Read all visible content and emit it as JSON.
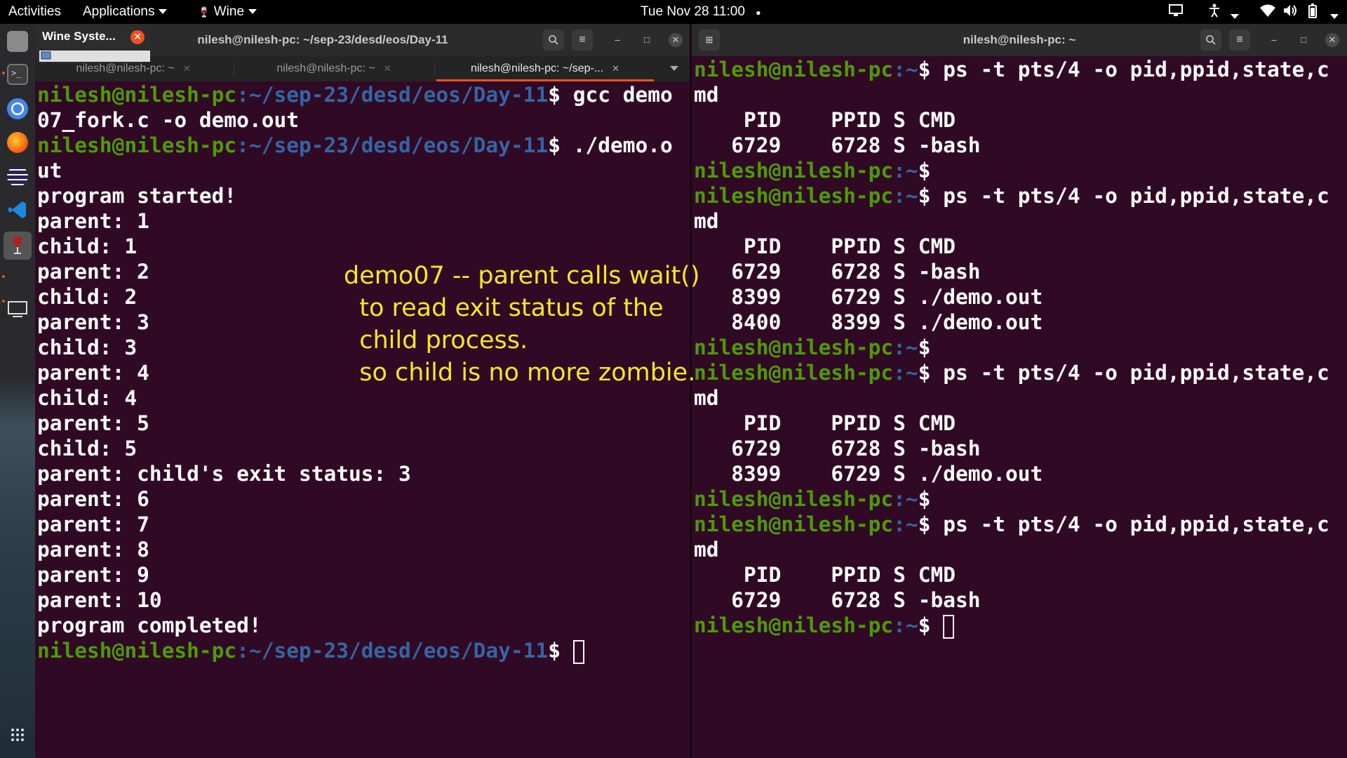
{
  "topbar": {
    "activities": "Activities",
    "applications": "Applications",
    "wine": "Wine",
    "clock": "Tue Nov 28  11:00"
  },
  "dock": {
    "items": [
      "files-icon",
      "terminal-icon",
      "chrome-icon",
      "firefox-icon",
      "eclipse-icon",
      "vscode-icon",
      "wine-icon",
      "screen-icon",
      "apps-grid-icon"
    ]
  },
  "wine_popup": {
    "title": "Wine Syste..."
  },
  "left_terminal": {
    "title": "nilesh@nilesh-pc: ~/sep-23/desd/eos/Day-11",
    "tabs": [
      {
        "label": "nilesh@nilesh-pc: ~"
      },
      {
        "label": "nilesh@nilesh-pc: ~"
      },
      {
        "label": "nilesh@nilesh-pc: ~/sep-..."
      }
    ],
    "prompt_user": "nilesh@nilesh-pc",
    "prompt_path": ":~/sep-23/desd/eos/Day-11",
    "lines": [
      {
        "type": "prompt",
        "cmd": "$ gcc demo"
      },
      {
        "type": "out",
        "text": "07_fork.c -o demo.out"
      },
      {
        "type": "prompt",
        "cmd": "$ ./demo.o"
      },
      {
        "type": "out",
        "text": "ut"
      },
      {
        "type": "out",
        "text": "program started!"
      },
      {
        "type": "out",
        "text": "parent: 1"
      },
      {
        "type": "out",
        "text": "child: 1"
      },
      {
        "type": "out",
        "text": "parent: 2"
      },
      {
        "type": "out",
        "text": "child: 2"
      },
      {
        "type": "out",
        "text": "parent: 3"
      },
      {
        "type": "out",
        "text": "child: 3"
      },
      {
        "type": "out",
        "text": "parent: 4"
      },
      {
        "type": "out",
        "text": "child: 4"
      },
      {
        "type": "out",
        "text": "parent: 5"
      },
      {
        "type": "out",
        "text": "child: 5"
      },
      {
        "type": "out",
        "text": "parent: child's exit status: 3"
      },
      {
        "type": "out",
        "text": "parent: 6"
      },
      {
        "type": "out",
        "text": "parent: 7"
      },
      {
        "type": "out",
        "text": "parent: 8"
      },
      {
        "type": "out",
        "text": "parent: 9"
      },
      {
        "type": "out",
        "text": "parent: 10"
      },
      {
        "type": "out",
        "text": "program completed!"
      },
      {
        "type": "prompt",
        "cmd": "$ ",
        "cursor": true
      }
    ]
  },
  "right_terminal": {
    "title": "nilesh@nilesh-pc: ~",
    "prompt_user": "nilesh@nilesh-pc",
    "prompt_path": ":~",
    "lines": [
      {
        "type": "prompt",
        "cmd": "$ ps -t pts/4 -o pid,ppid,state,c"
      },
      {
        "type": "out",
        "text": "md"
      },
      {
        "type": "out",
        "text": "    PID    PPID S CMD"
      },
      {
        "type": "out",
        "text": "   6729    6728 S -bash"
      },
      {
        "type": "prompt",
        "cmd": "$"
      },
      {
        "type": "prompt",
        "cmd": "$ ps -t pts/4 -o pid,ppid,state,c"
      },
      {
        "type": "out",
        "text": "md"
      },
      {
        "type": "out",
        "text": "    PID    PPID S CMD"
      },
      {
        "type": "out",
        "text": "   6729    6728 S -bash"
      },
      {
        "type": "out",
        "text": "   8399    6729 S ./demo.out"
      },
      {
        "type": "out",
        "text": "   8400    8399 S ./demo.out"
      },
      {
        "type": "prompt",
        "cmd": "$"
      },
      {
        "type": "prompt",
        "cmd": "$ ps -t pts/4 -o pid,ppid,state,c"
      },
      {
        "type": "out",
        "text": "md"
      },
      {
        "type": "out",
        "text": "    PID    PPID S CMD"
      },
      {
        "type": "out",
        "text": "   6729    6728 S -bash"
      },
      {
        "type": "out",
        "text": "   8399    6729 S ./demo.out"
      },
      {
        "type": "prompt",
        "cmd": "$"
      },
      {
        "type": "prompt",
        "cmd": "$ ps -t pts/4 -o pid,ppid,state,c"
      },
      {
        "type": "out",
        "text": "md"
      },
      {
        "type": "out",
        "text": "    PID    PPID S CMD"
      },
      {
        "type": "out",
        "text": "   6729    6728 S -bash"
      },
      {
        "type": "prompt",
        "cmd": "$ ",
        "cursor": true
      }
    ]
  },
  "annotation": {
    "text": "demo07 -- parent calls wait()\n  to read exit status of the\n  child process.\n  so child is no more zombie."
  },
  "colors": {
    "terminal_bg": "#300a24",
    "prompt_user": "#4e9a06",
    "prompt_path": "#3465a4",
    "annotation": "#f5e52a",
    "accent": "#e95420"
  }
}
